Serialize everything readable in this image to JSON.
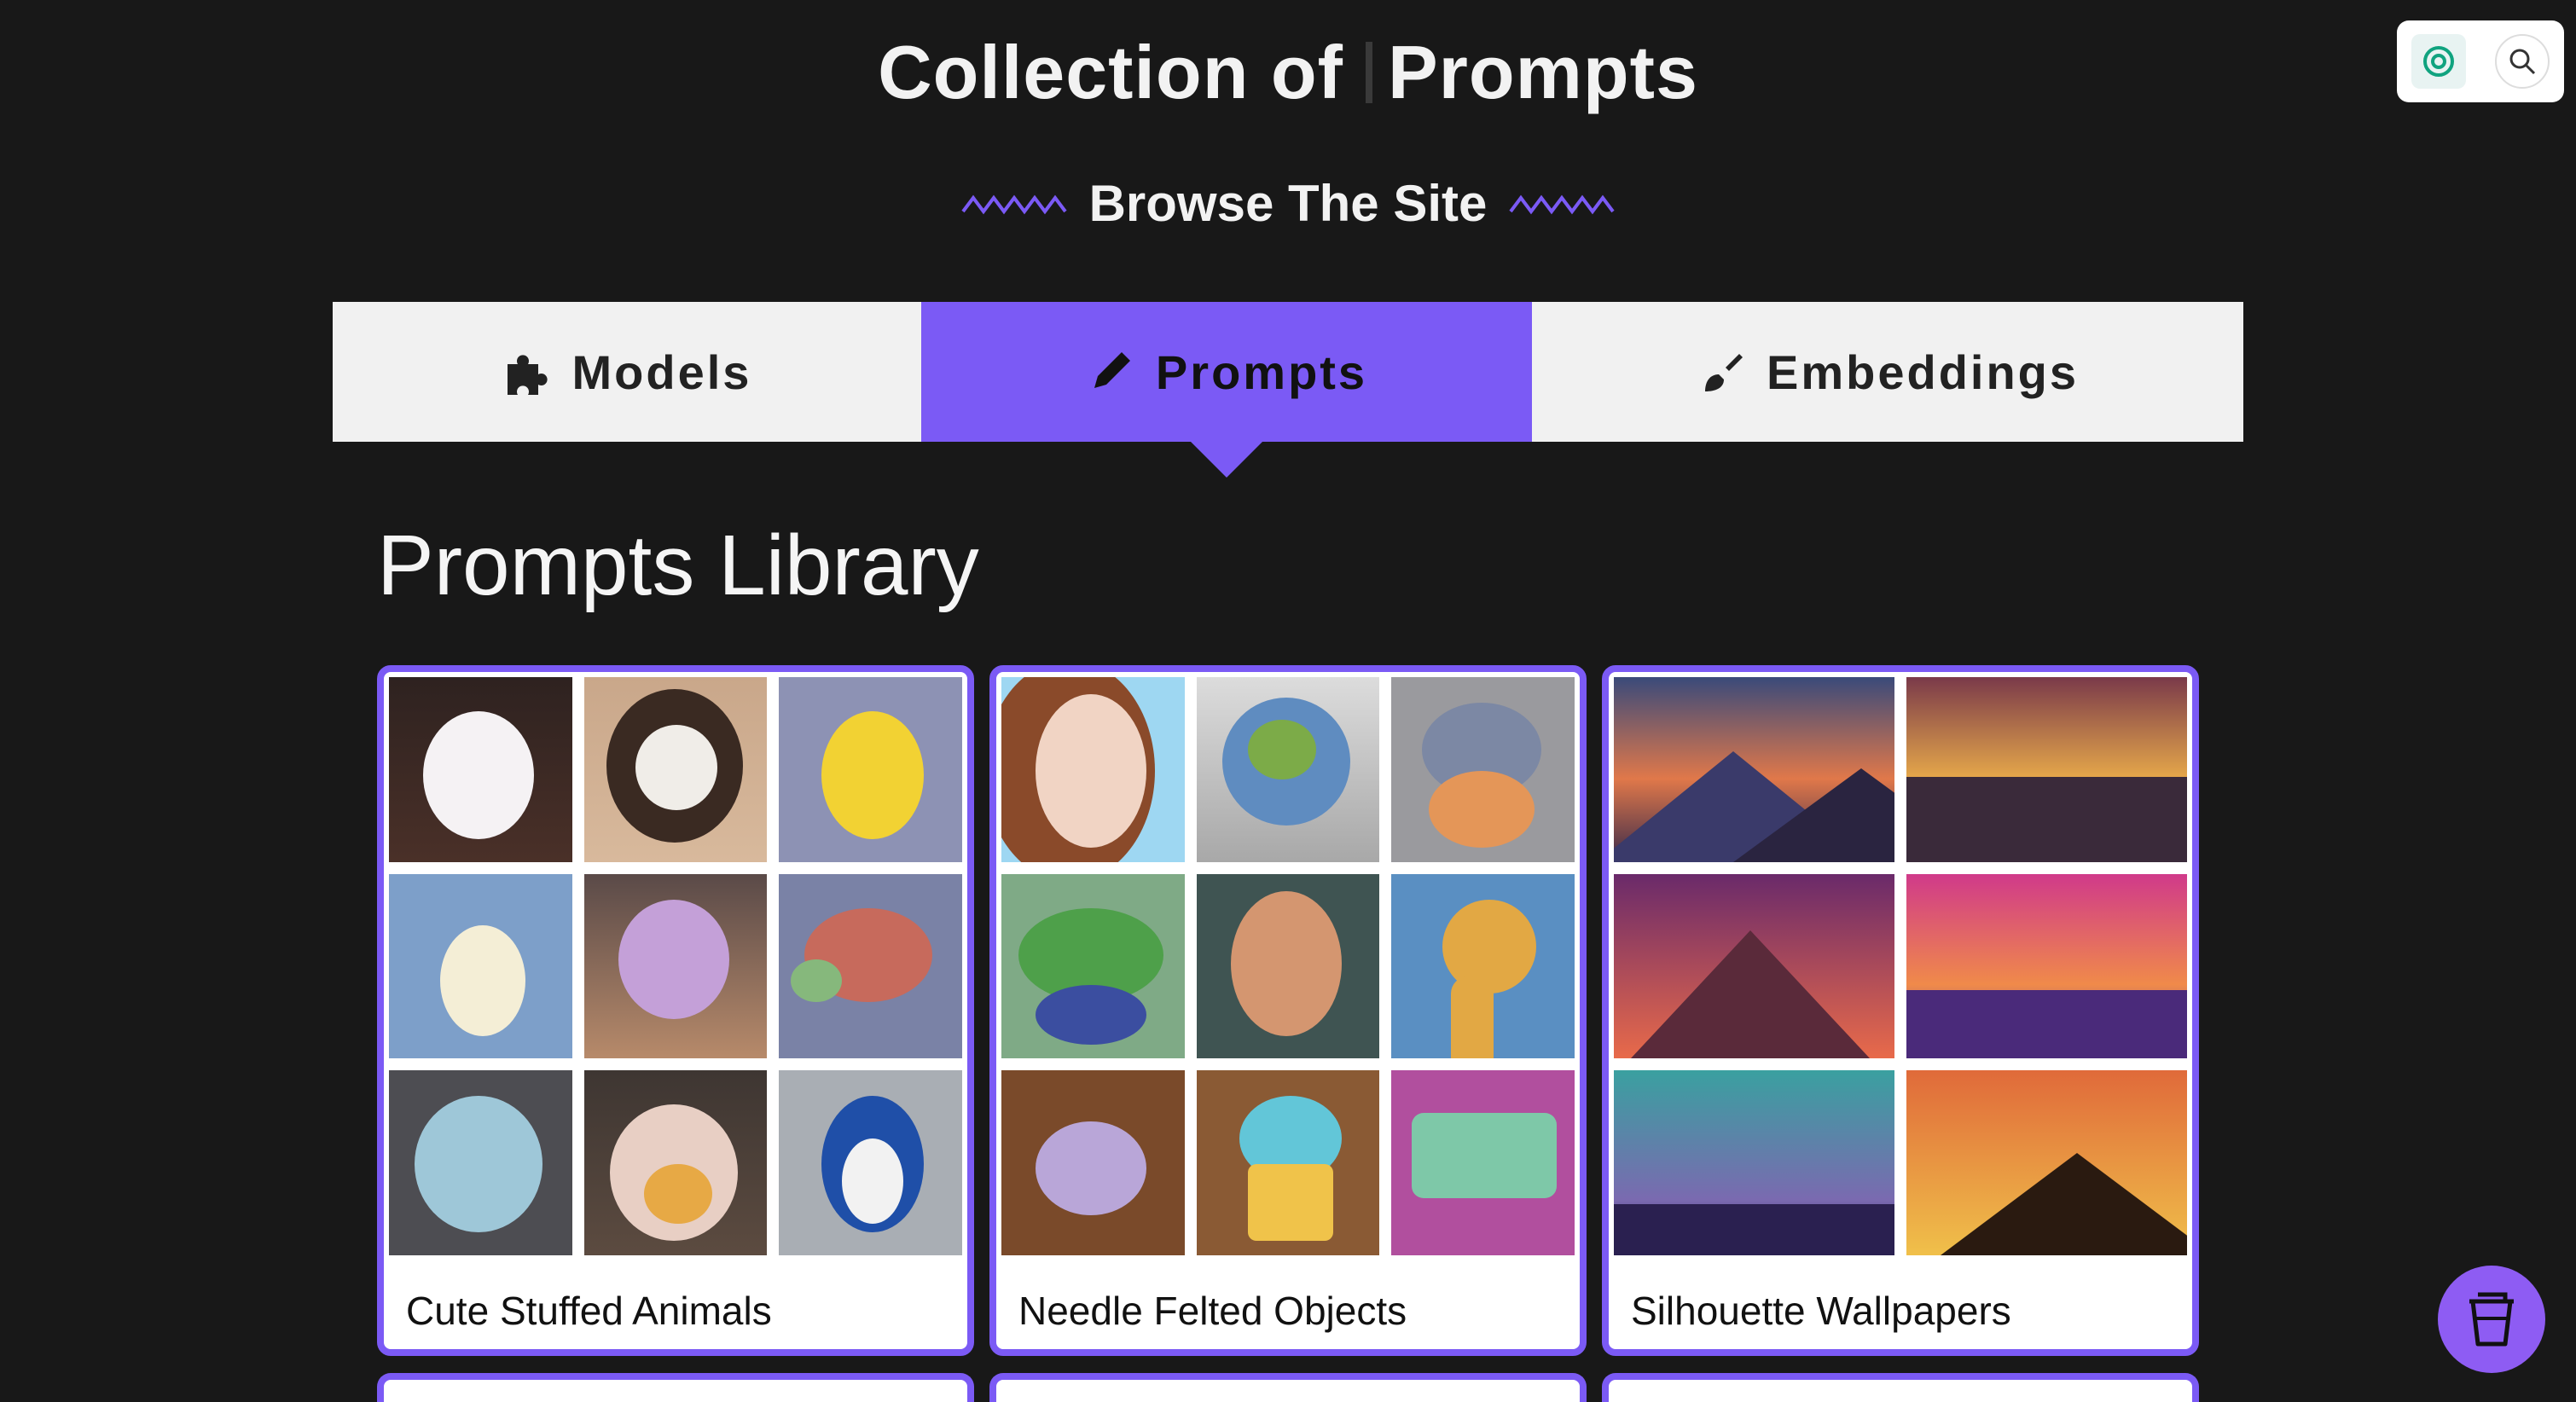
{
  "header": {
    "title_part1": "Collection of",
    "title_part2": "Prompts",
    "subtitle": "Browse The Site"
  },
  "tabs": [
    {
      "label": "Models",
      "icon": "puzzle-icon",
      "active": false
    },
    {
      "label": "Prompts",
      "icon": "pencil-icon",
      "active": true
    },
    {
      "label": "Embeddings",
      "icon": "brush-icon",
      "active": false
    }
  ],
  "library": {
    "title": "Prompts Library",
    "cards": [
      {
        "label": "Cute Stuffed Animals"
      },
      {
        "label": "Needle Felted Objects"
      },
      {
        "label": "Silhouette Wallpapers"
      }
    ]
  },
  "colors": {
    "accent": "#7b5af5",
    "background": "#181818",
    "tab_bg": "#f1f1f1"
  },
  "widgets": {
    "assistant_icon": "chatgpt-logo-icon",
    "search_icon": "search-icon",
    "floating_button_icon": "coffee-cup-icon"
  }
}
